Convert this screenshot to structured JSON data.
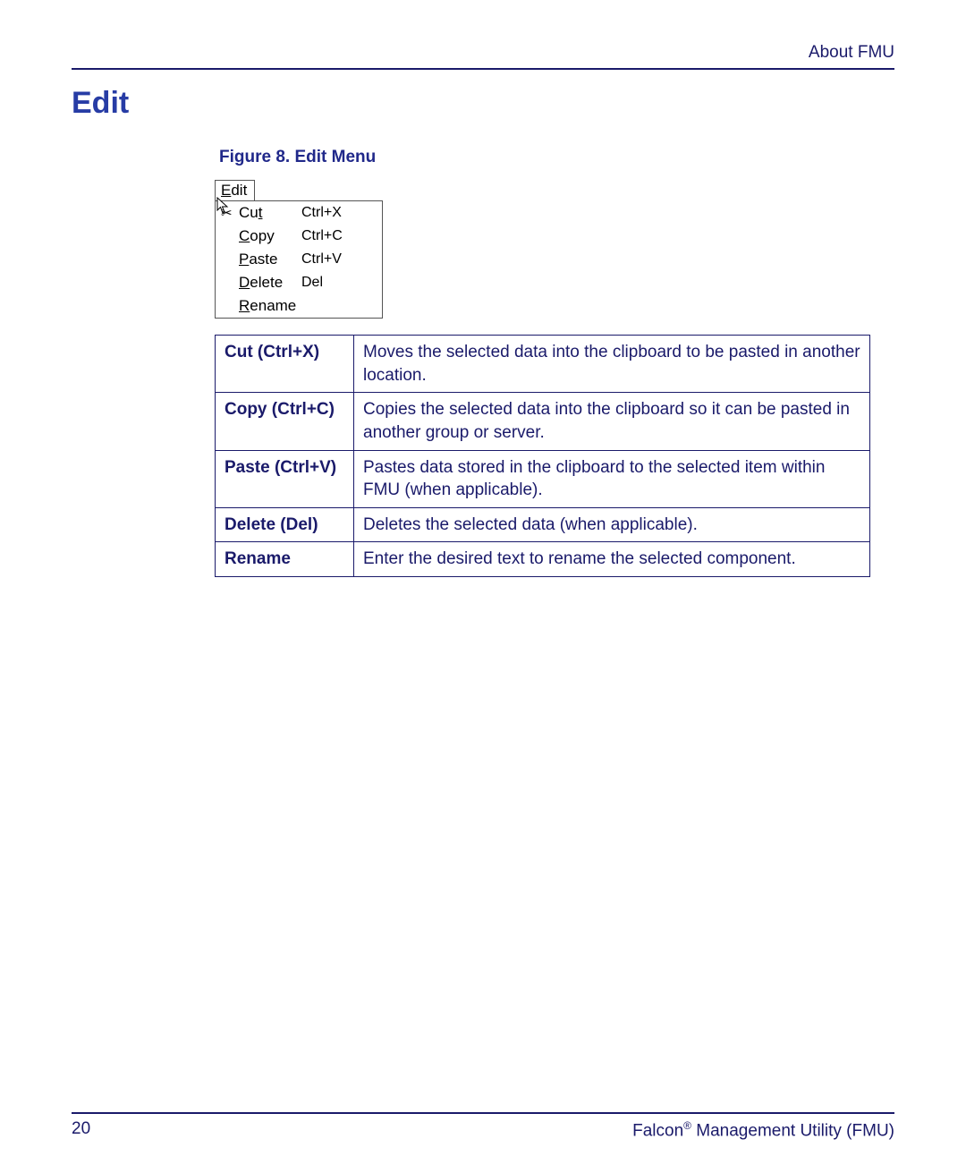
{
  "header": {
    "right": "About FMU"
  },
  "title": "Edit",
  "figure_caption": "Figure 8. Edit Menu",
  "menu": {
    "tab_prefix": "E",
    "tab_rest": "dit",
    "items": [
      {
        "icon": "scissors",
        "ul": "t",
        "before": "Cu",
        "after": "",
        "shortcut": "Ctrl+X"
      },
      {
        "icon": "",
        "ul": "C",
        "before": "",
        "after": "opy",
        "shortcut": "Ctrl+C"
      },
      {
        "icon": "",
        "ul": "P",
        "before": "",
        "after": "aste",
        "shortcut": "Ctrl+V"
      },
      {
        "icon": "",
        "ul": "D",
        "before": "",
        "after": "elete",
        "shortcut": "Del"
      },
      {
        "icon": "",
        "ul": "R",
        "before": "",
        "after": "ename",
        "shortcut": ""
      }
    ]
  },
  "table": [
    {
      "term": "Cut (Ctrl+X)",
      "desc": "Moves the selected data into the clipboard to be pasted in another location."
    },
    {
      "term": "Copy (Ctrl+C)",
      "desc": "Copies the selected data into the clipboard so it can be pasted in another group or server."
    },
    {
      "term": "Paste (Ctrl+V)",
      "desc": "Pastes data stored in the clipboard to the selected item within FMU (when applicable)."
    },
    {
      "term": "Delete (Del)",
      "desc": "Deletes the selected data (when applicable)."
    },
    {
      "term": "Rename",
      "desc": "Enter the desired text to rename the selected component."
    }
  ],
  "footer": {
    "page": "20",
    "product_prefix": "Falcon",
    "reg": "®",
    "product_suffix": " Management Utility (FMU)"
  }
}
